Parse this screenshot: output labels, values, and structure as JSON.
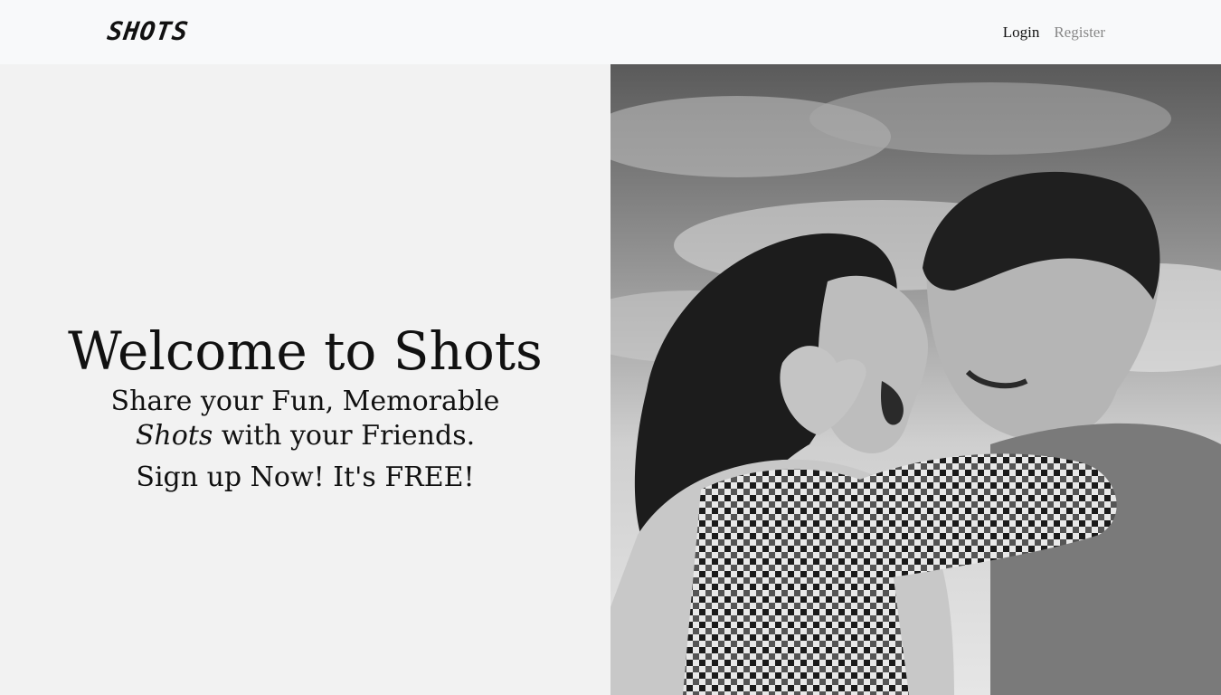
{
  "brand": {
    "name": "SHOTS"
  },
  "nav": {
    "login": "Login",
    "register": "Register"
  },
  "hero": {
    "title": "Welcome to Shots",
    "sub_before": "Share your Fun, Memorable ",
    "sub_emph": "Shots",
    "sub_after": " with your Friends.",
    "cta": "Sign up Now! It's FREE!"
  },
  "colors": {
    "navbar_bg": "#f8f9fa",
    "panel_bg": "#f2f2f2",
    "nav_inactive": "#888888",
    "text": "#111111"
  }
}
